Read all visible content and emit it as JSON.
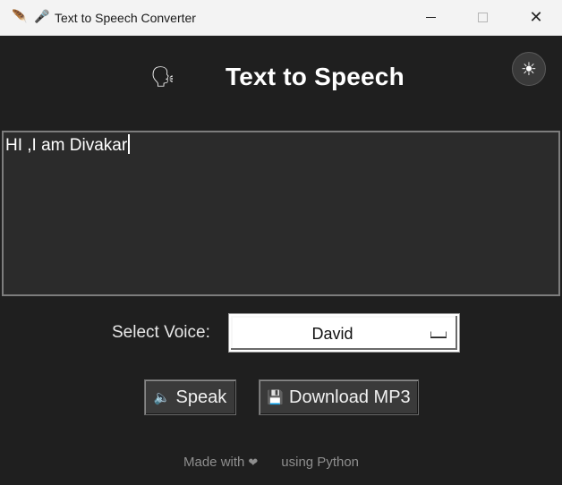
{
  "window": {
    "title": "Text to Speech Converter",
    "app_icon": "feather-icon",
    "title_icon": "microphone-icon",
    "controls": {
      "minimize": "minimize-icon",
      "maximize": "maximize-icon",
      "close": "✕"
    }
  },
  "header": {
    "icon": "speaking-head-icon",
    "title": "Text to Speech",
    "theme_toggle_icon": "sun-icon"
  },
  "text_input": {
    "value": "HI ,I am Divakar"
  },
  "voice": {
    "label": "Select Voice:",
    "selected": "David"
  },
  "buttons": {
    "speak": {
      "icon": "speaker-icon",
      "label": "Speak"
    },
    "download": {
      "icon": "floppy-disk-icon",
      "label": "Download MP3"
    }
  },
  "footer": {
    "prefix": "Made with",
    "heart_icon": "heart-icon",
    "suffix": "using Python"
  },
  "colors": {
    "background": "#1f1f1f",
    "textarea_bg": "#2b2b2b",
    "button_bg": "#3a3a3a",
    "titlebar_bg": "#f3f3f3"
  }
}
